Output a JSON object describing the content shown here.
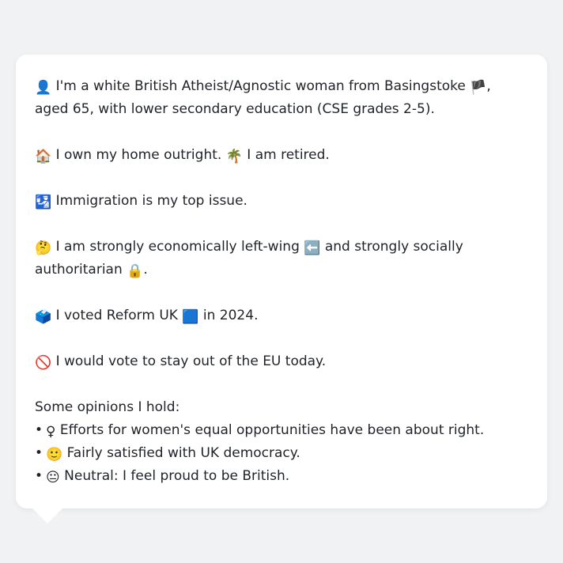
{
  "profile": {
    "intro": {
      "icon": "👤",
      "text_a": "I'm a white British Atheist/Agnostic woman from Basingstoke ",
      "flag": "🏴",
      "text_b": ", aged 65, with lower secondary education (CSE grades 2-5)."
    },
    "home": {
      "icon_home": "🏠",
      "text_home": "I own my home outright.",
      "icon_work": "🌴",
      "text_work": "I am retired."
    },
    "issue": {
      "icon": "🛂",
      "text": "Immigration is my top issue."
    },
    "politics": {
      "icon": "🤔",
      "text_a": "I am strongly economically left-wing ",
      "icon_left": "⬅️",
      "text_b": " and strongly socially authoritarian ",
      "icon_lock": "🔒",
      "text_c": "."
    },
    "vote": {
      "icon": "🗳️",
      "text_a": "I voted Reform UK ",
      "icon_party": "🟦",
      "text_b": " in 2024."
    },
    "eu": {
      "icon": "🚫",
      "text": "I would vote to stay out of the EU today."
    },
    "opinions_heading": "Some opinions I hold:",
    "opinions": [
      {
        "bullet": "•",
        "icon": "♀",
        "text": "Efforts for women's equal opportunities have been about right."
      },
      {
        "bullet": "•",
        "icon": "🙂",
        "text": "Fairly satisfied with UK democracy."
      },
      {
        "bullet": "•",
        "icon": "😐",
        "text": "Neutral: I feel proud to be British."
      }
    ]
  }
}
